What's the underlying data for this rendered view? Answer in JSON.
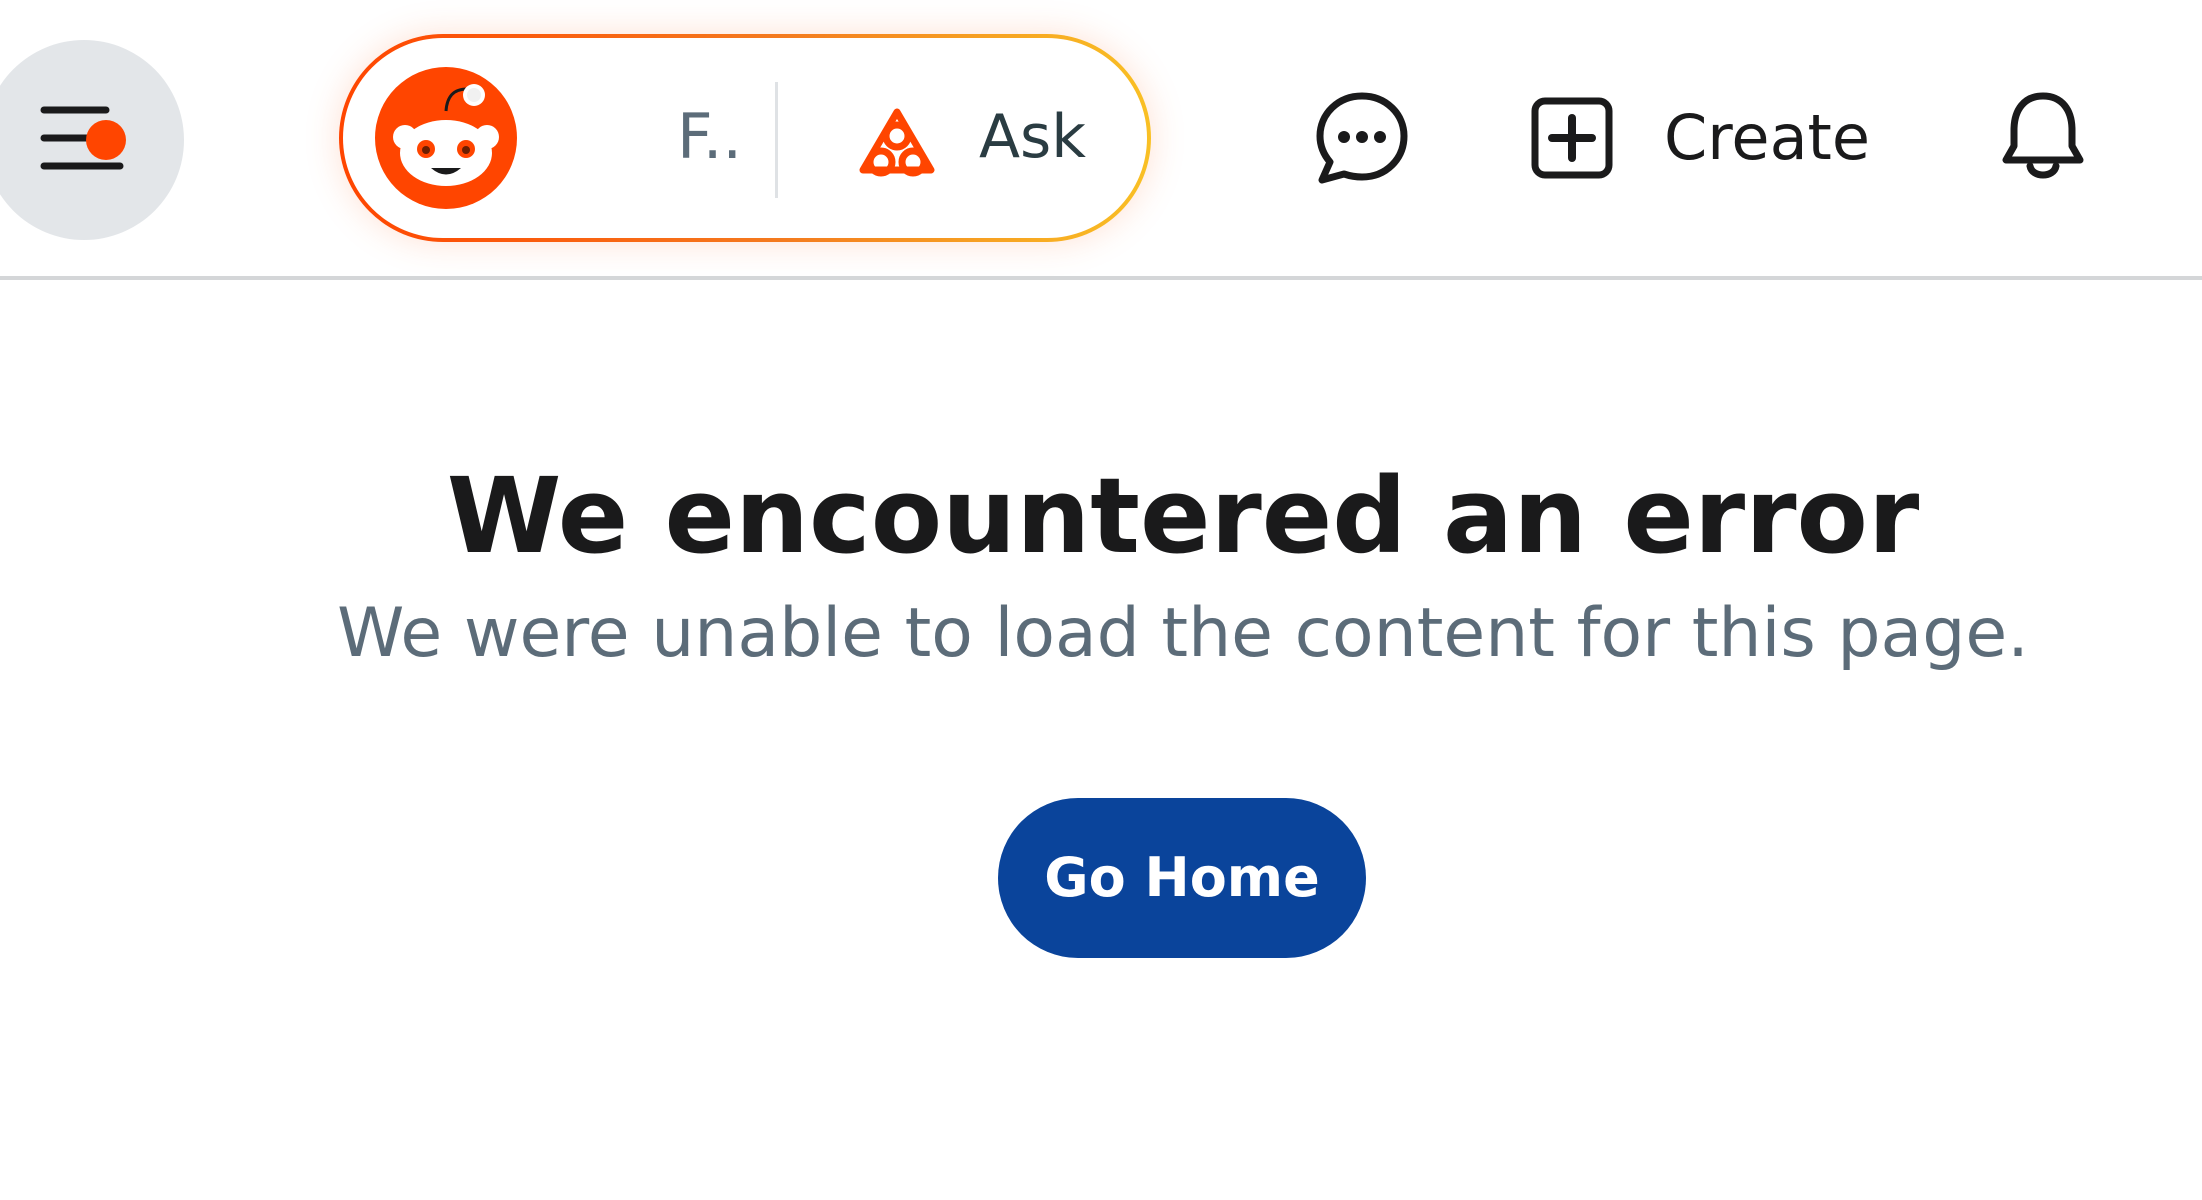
{
  "header": {
    "menu": {
      "icon": "hamburger-menu-icon",
      "has_notification": true
    },
    "search": {
      "logo": "reddit-snoo-logo",
      "text": "F..",
      "ask_icon": "reddit-answers-icon",
      "ask_label": "Ask"
    },
    "chat": {
      "icon": "chat-bubble-icon"
    },
    "create": {
      "icon": "plus-square-icon",
      "label": "Create"
    },
    "notifications": {
      "icon": "bell-icon"
    }
  },
  "error": {
    "title": "We encountered an error",
    "subtitle": "We were unable to load the content for this page.",
    "button_label": "Go Home"
  },
  "colors": {
    "brand": "#ff4500",
    "primary_button": "#0a449b",
    "text": "#1a1a1b",
    "muted_text": "#5c6c79"
  }
}
